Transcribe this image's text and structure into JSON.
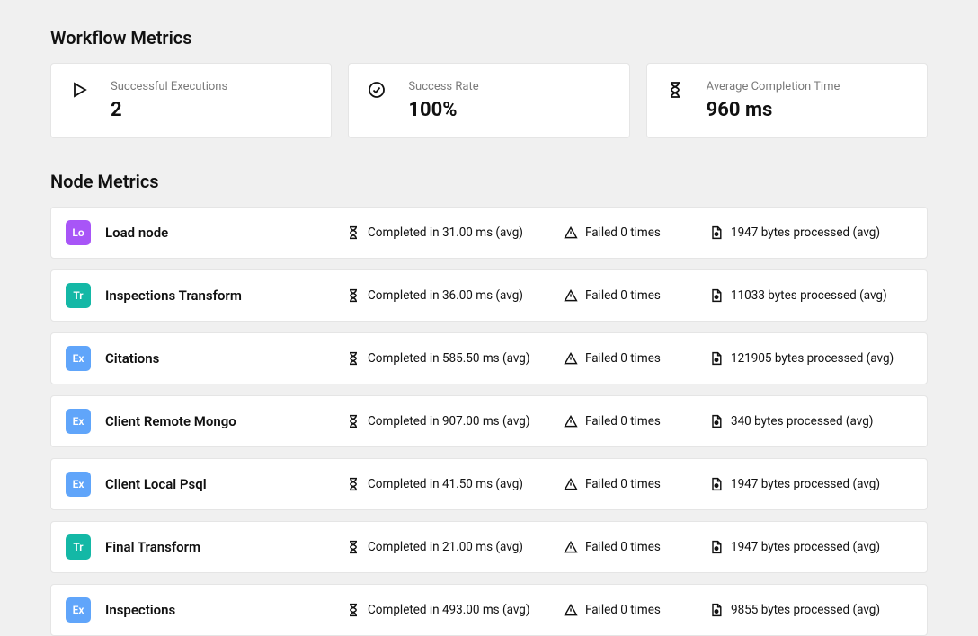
{
  "workflow": {
    "title": "Workflow Metrics",
    "cards": [
      {
        "icon": "play",
        "label": "Successful Executions",
        "value": "2"
      },
      {
        "icon": "check",
        "label": "Success Rate",
        "value": "100%"
      },
      {
        "icon": "hour",
        "label": "Average Completion Time",
        "value": "960 ms"
      }
    ]
  },
  "nodes": {
    "title": "Node Metrics",
    "rows": [
      {
        "badge": "Lo",
        "name": "Load node",
        "time": "Completed in 31.00 ms (avg)",
        "fail": "Failed 0 times",
        "bytes": "1947 bytes processed (avg)"
      },
      {
        "badge": "Tr",
        "name": "Inspections Transform",
        "time": "Completed in 36.00 ms (avg)",
        "fail": "Failed 0 times",
        "bytes": "11033 bytes processed (avg)"
      },
      {
        "badge": "Ex",
        "name": "Citations",
        "time": "Completed in 585.50 ms (avg)",
        "fail": "Failed 0 times",
        "bytes": "121905 bytes processed (avg)"
      },
      {
        "badge": "Ex",
        "name": "Client Remote Mongo",
        "time": "Completed in 907.00 ms (avg)",
        "fail": "Failed 0 times",
        "bytes": "340 bytes processed (avg)"
      },
      {
        "badge": "Ex",
        "name": "Client Local Psql",
        "time": "Completed in 41.50 ms (avg)",
        "fail": "Failed 0 times",
        "bytes": "1947 bytes processed (avg)"
      },
      {
        "badge": "Tr",
        "name": "Final Transform",
        "time": "Completed in 21.00 ms (avg)",
        "fail": "Failed 0 times",
        "bytes": "1947 bytes processed (avg)"
      },
      {
        "badge": "Ex",
        "name": "Inspections",
        "time": "Completed in 493.00 ms (avg)",
        "fail": "Failed 0 times",
        "bytes": "9855 bytes processed (avg)"
      }
    ]
  }
}
